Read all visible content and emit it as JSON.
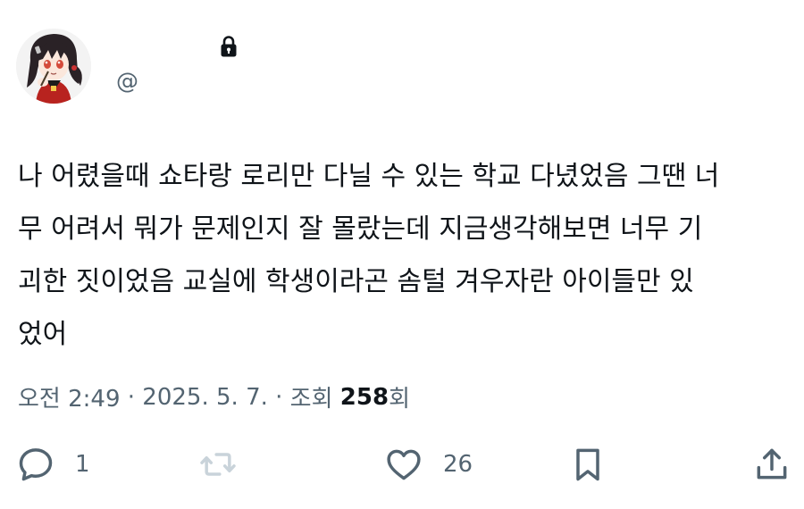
{
  "user": {
    "display_name": "",
    "handle": "@",
    "locked": true
  },
  "tweet": {
    "text": "나 어렸을때 쇼타랑 로리만 다닐 수 있는 학교 다녔었음 그땐 너\n무 어려서 뭐가 문제인지 잘 몰랐는데 지금생각해보면 너무 기\n괴한 짓이었음 교실에 학생이라곤 솜털 겨우자란 아이들만 있\n었어"
  },
  "meta": {
    "time": "오전 2:49",
    "separator": " · ",
    "date": "2025. 5. 7.",
    "views_prefix": "조회 ",
    "views_count": "258",
    "views_suffix": "회"
  },
  "actions": {
    "reply_count": "1",
    "retweet_count": "",
    "like_count": "26"
  },
  "icons": {
    "avatar": "anime-girl-avatar",
    "lock": "lock-icon",
    "reply": "reply-icon",
    "retweet": "retweet-icon",
    "like": "heart-icon",
    "bookmark": "bookmark-icon",
    "share": "share-icon"
  },
  "colors": {
    "text": "#0f1419",
    "secondary": "#536471",
    "retweet_disabled": "#c9d3da"
  }
}
